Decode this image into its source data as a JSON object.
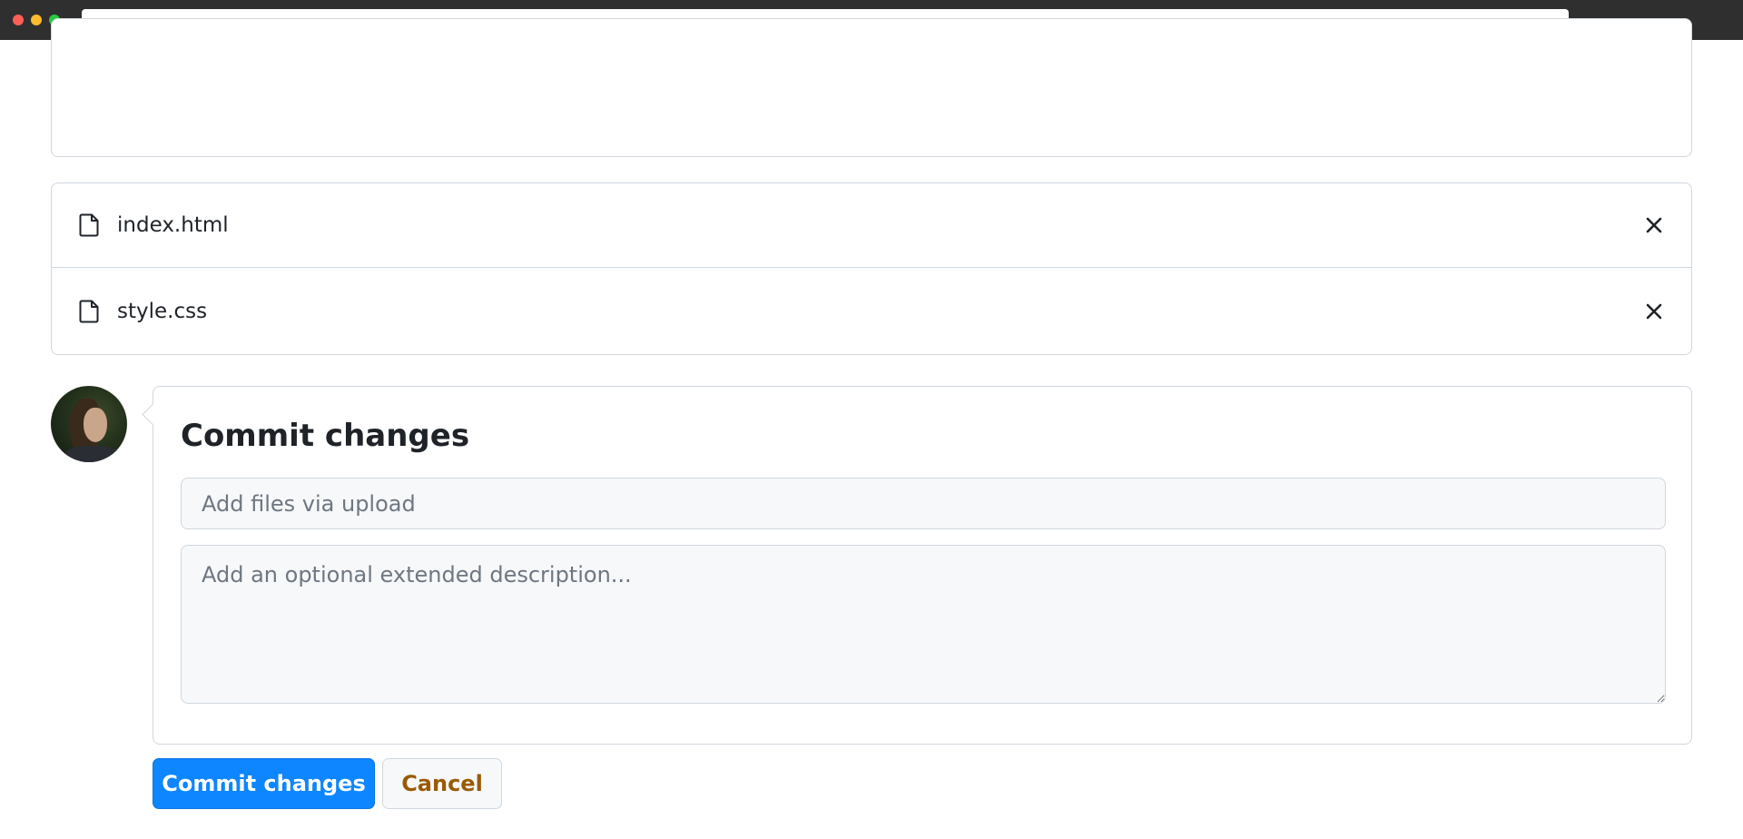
{
  "browser": {
    "window_controls": [
      "close",
      "minimize",
      "maximize"
    ]
  },
  "files": [
    {
      "name": "index.html",
      "icon": "file-icon",
      "remove_icon": "close-icon"
    },
    {
      "name": "style.css",
      "icon": "file-icon",
      "remove_icon": "close-icon"
    }
  ],
  "commit": {
    "title": "Commit changes",
    "summary_placeholder": "Add files via upload",
    "summary_value": "",
    "description_placeholder": "Add an optional extended description...",
    "description_value": ""
  },
  "actions": {
    "commit_label": "Commit changes",
    "cancel_label": "Cancel"
  },
  "colors": {
    "primary": "#0d86ff",
    "cancel_text": "#9a5a00",
    "border": "#d0d7de",
    "input_bg": "#f6f8fa"
  }
}
